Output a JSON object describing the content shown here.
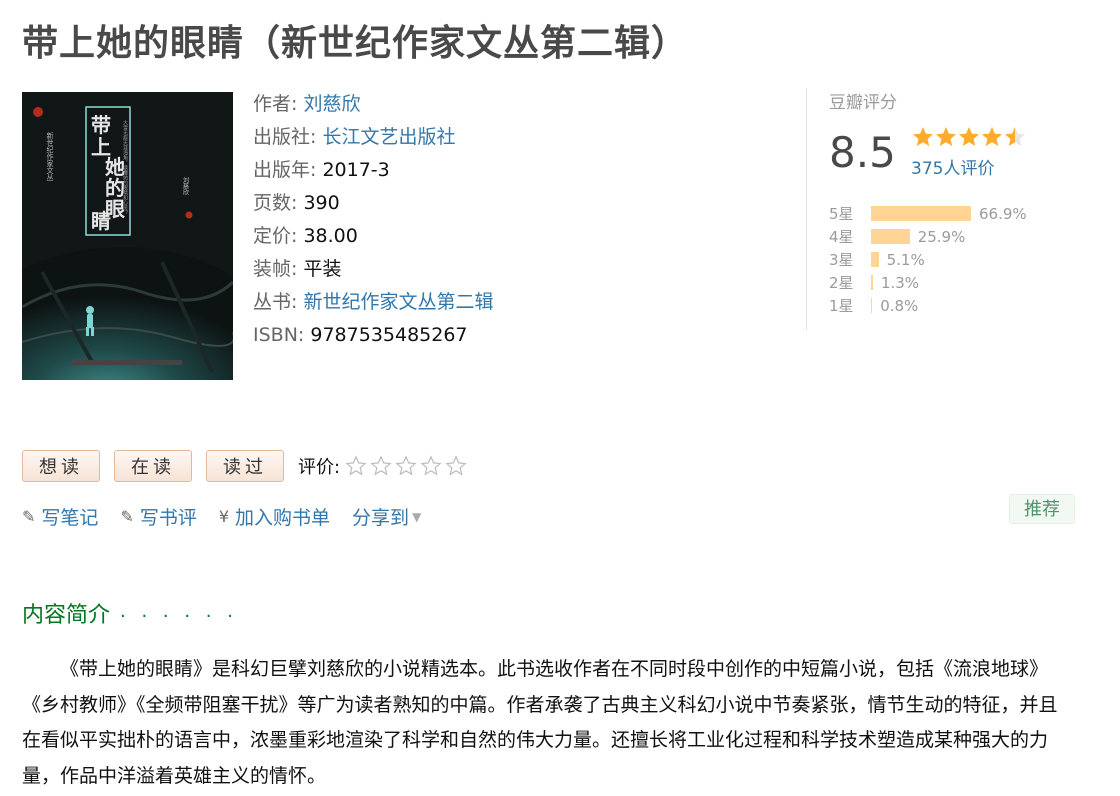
{
  "title": "带上她的眼睛（新世纪作家文丛第二辑）",
  "cover": {
    "title_chars": [
      "带",
      "上",
      "她",
      "的",
      "眼",
      "睛"
    ],
    "series_vertical": "新世纪作家文丛",
    "tagline": "大雪无痕天涯海角，读懂她的眼睛和心灵？",
    "author_small": "刘慈欣"
  },
  "info": {
    "author_label": "作者:",
    "author": "刘慈欣",
    "publisher_label": "出版社:",
    "publisher": "长江文艺出版社",
    "year_label": "出版年:",
    "year": "2017-3",
    "pages_label": "页数:",
    "pages": "390",
    "price_label": "定价:",
    "price": "38.00",
    "binding_label": "装帧:",
    "binding": "平装",
    "series_label": "丛书:",
    "series": "新世纪作家文丛第二辑",
    "isbn_label": "ISBN:",
    "isbn": "9787535485267"
  },
  "rating": {
    "label": "豆瓣评分",
    "score": "8.5",
    "stars_value": 4.5,
    "people": "375人评价",
    "breakdown": [
      {
        "label": "5星",
        "percent": "66.9%",
        "value": 66.9
      },
      {
        "label": "4星",
        "percent": "25.9%",
        "value": 25.9
      },
      {
        "label": "3星",
        "percent": "5.1%",
        "value": 5.1
      },
      {
        "label": "2星",
        "percent": "1.3%",
        "value": 1.3
      },
      {
        "label": "1星",
        "percent": "0.8%",
        "value": 0.8
      }
    ]
  },
  "actions": {
    "want": "想读",
    "reading": "在读",
    "read": "读过",
    "rate_label": "评价:"
  },
  "links": {
    "note": "写笔记",
    "review": "写书评",
    "cart": "加入购书单",
    "share": "分享到"
  },
  "recommend": "推荐",
  "section": {
    "title": "内容简介",
    "dots": "· · · · · ·"
  },
  "intro": "《带上她的眼睛》是科幻巨擘刘慈欣的小说精选本。此书选收作者在不同时段中创作的中短篇小说，包括《流浪地球》《乡村教师》《全频带阻塞干扰》等广为读者熟知的中篇。作者承袭了古典主义科幻小说中节奏紧张，情节生动的特征，并且在看似平实拙朴的语言中，浓墨重彩地渲染了科学和自然的伟大力量。还擅长将工业化过程和科学技术塑造成某种强大的力量，作品中洋溢着英雄主义的情怀。",
  "colors": {
    "link": "#3377aa",
    "green": "#007722",
    "star": "#ffac2d",
    "bar": "#ffd596"
  }
}
